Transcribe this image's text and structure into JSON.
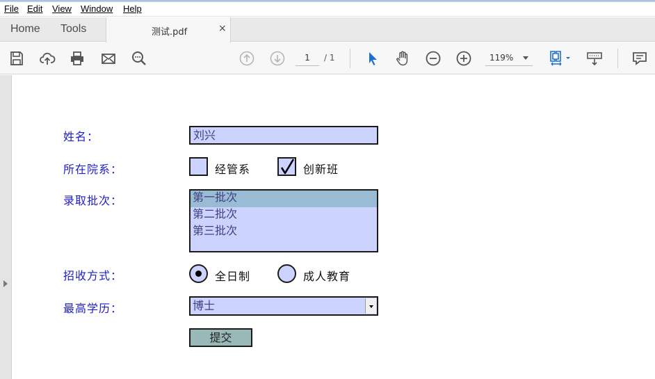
{
  "menu": [
    "File",
    "Edit",
    "View",
    "Window",
    "Help"
  ],
  "tabs": {
    "home": "Home",
    "tools": "Tools",
    "document": "测试.pdf",
    "close_glyph": "×"
  },
  "toolbar": {
    "current_page": "1",
    "total_pages": "/ 1",
    "zoom": "119%"
  },
  "form": {
    "name_label": "姓名：",
    "name_value": "刘兴",
    "dept_label": "所在院系：",
    "dept_options": [
      {
        "label": "经管系",
        "checked": false
      },
      {
        "label": "创新班",
        "checked": true
      }
    ],
    "batch_label": "录取批次：",
    "batch_options": [
      "第一批次",
      "第二批次",
      "第三批次"
    ],
    "batch_selected": "第一批次",
    "mode_label": "招收方式：",
    "mode_options": [
      {
        "label": "全日制",
        "selected": true
      },
      {
        "label": "成人教育",
        "selected": false
      }
    ],
    "edu_label": "最高学历：",
    "edu_value": "博士",
    "submit_label": "提交"
  },
  "colors": {
    "field_bg": "#ccd3ff",
    "label_blue": "#1d1dcc",
    "list_selected": "#99bbd4",
    "button_bg": "#99b8b8",
    "toolbar_accent": "#1a6fd1"
  }
}
